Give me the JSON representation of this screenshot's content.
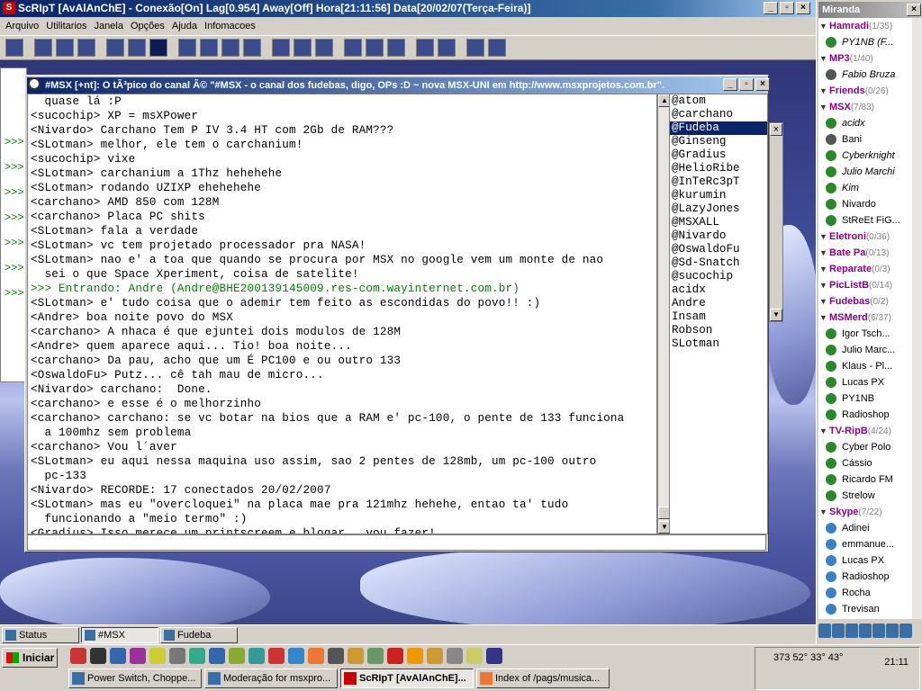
{
  "app": {
    "title": "ScRIpT [AvAlAnChE] - Conexão[On] Lag[0.954] Away[Off] Hora[21:11:56] Data[20/02/07(Terça-Feira)]",
    "menu": [
      "Arquivo",
      "Utilitarios",
      "Janela",
      "Opções",
      "Ajuda",
      "Infomacoes"
    ]
  },
  "channel": {
    "title": "#MSX [+nt]: O tÃ³pico do canal Ã© \"#MSX - o canal dos fudebas, digo, OPs :D ~ nova MSX-UNI em http://www.msxprojetos.com.br\".",
    "lines": [
      {
        "t": "  quase lá :P"
      },
      {
        "t": "<sucochip> XP = msXPower"
      },
      {
        "t": "<Nivardo> Carchano Tem P IV 3.4 HT com 2Gb de RAM???"
      },
      {
        "t": "<SLotman> melhor, ele tem o carchanium!"
      },
      {
        "t": "<sucochip> vixe"
      },
      {
        "t": "<SLotman> carchanium a 1Thz hehehehe"
      },
      {
        "t": "<SLotman> rodando UZIXP ehehehehe"
      },
      {
        "t": "<carchano> AMD 850 com 128M"
      },
      {
        "t": "<carchano> Placa PC shits"
      },
      {
        "t": "<SLotman> fala a verdade"
      },
      {
        "t": "<SLotman> vc tem projetado processador pra NASA!"
      },
      {
        "t": "<SLotman> nao e' a toa que quando se procura por MSX no google vem um monte de nao"
      },
      {
        "t": "  sei o que Space Xperiment, coisa de satelite!"
      },
      {
        "t": ">>> Entrando: Andre (Andre@BHE200139145009.res-com.wayinternet.com.br)",
        "g": true
      },
      {
        "t": "<SLotman> e' tudo coisa que o ademir tem feito as escondidas do povo!! :)"
      },
      {
        "t": "<Andre> boa noite povo do MSX"
      },
      {
        "t": "<carchano> A nhaca é que ejuntei dois modulos de 128M"
      },
      {
        "t": "<Andre> quem aparece aqui... Tio! boa noite..."
      },
      {
        "t": "<carchano> Da pau, acho que um É PC100 e ou outro 133"
      },
      {
        "t": "<OswaldoFu> Putz... cê tah mau de micro..."
      },
      {
        "t": "<Nivardo> carchano:  Done."
      },
      {
        "t": "<carchano> e esse é o melhorzinho"
      },
      {
        "t": "<carchano> carchano: se vc botar na bios que a RAM e' pc-100, o pente de 133 funciona"
      },
      {
        "t": "  a 100mhz sem problema"
      },
      {
        "t": "<carchano> Vou l´aver"
      },
      {
        "t": "<SLotman> eu aqui nessa maquina uso assim, sao 2 pentes de 128mb, um pc-100 outro"
      },
      {
        "t": "  pc-133"
      },
      {
        "t": "<Nivardo> RECORDE: 17 conectados 20/02/2007"
      },
      {
        "t": "<SLotman> mas eu \"overcloquei\" na placa mae pra 121mhz hehehe, entao ta' tudo"
      },
      {
        "t": "  funcionando a \"meio termo\" :)"
      },
      {
        "t": "<Gradius> Isso merece um printscreem e blogar.. vou fazer!"
      }
    ],
    "nicks": [
      "@atom",
      "@carchano",
      "@Fudeba",
      "@Ginseng",
      "@Gradius",
      "@HelioRibe",
      "@InTeRc3pT",
      "@kurumin",
      "@LazyJones",
      "@MSXALL",
      "@Nivardo",
      "@OswaldoFu",
      "@Sd-Snatch",
      "@sucochip",
      "acidx",
      "Andre",
      "Insam",
      "Robson",
      "SLotman"
    ],
    "selected_nick": "@Fudeba"
  },
  "bg": {
    "lines": [
      ">>>",
      ">>>",
      ">>>",
      ">>>",
      ">>>",
      ">>>",
      ">>>"
    ]
  },
  "switchbar": [
    "Status",
    "#MSX",
    "Fudeba"
  ],
  "miranda": {
    "title": "Miranda",
    "items": [
      {
        "g": "Hamradi",
        "c": "(1/35)"
      },
      {
        "n": "PY1NB (F...",
        "i": true,
        "col": "#2a8a2a"
      },
      {
        "g": "MP3",
        "c": "(1/40)"
      },
      {
        "n": "Fabio Bruza",
        "i": true,
        "col": "#555"
      },
      {
        "g": "Friends",
        "c": "(0/26)"
      },
      {
        "g": "MSX",
        "c": "(7/83)"
      },
      {
        "n": "acidx",
        "i": true,
        "col": "#2a8a2a"
      },
      {
        "n": "Bani",
        "col": "#555"
      },
      {
        "n": "Cyberknight",
        "i": true,
        "col": "#2a8a2a"
      },
      {
        "n": "Julio Marchi",
        "i": true,
        "col": "#2a8a2a"
      },
      {
        "n": "Kim",
        "i": true,
        "col": "#2a8a2a"
      },
      {
        "n": "Nivardo",
        "col": "#2a8a2a"
      },
      {
        "n": "StReEt FiG...",
        "col": "#2a8a2a"
      },
      {
        "g": "Eletroni",
        "c": "(0/36)"
      },
      {
        "g": "Bate Pa",
        "c": "(0/13)"
      },
      {
        "g": "Reparate",
        "c": "(0/3)"
      },
      {
        "g": "PicListB",
        "c": "(0/14)"
      },
      {
        "g": "Fudebas",
        "c": "(0/2)"
      },
      {
        "g": "MSMerd",
        "c": "(6/37)"
      },
      {
        "n": "Igor Tsch...",
        "col": "#2a8a2a"
      },
      {
        "n": "Julio Marc...",
        "col": "#2a8a2a"
      },
      {
        "n": "Klaus - Pl...",
        "col": "#2a8a2a"
      },
      {
        "n": "Lucas PX",
        "col": "#2a8a2a"
      },
      {
        "n": "PY1NB",
        "col": "#2a8a2a"
      },
      {
        "n": "Radioshop",
        "col": "#2a8a2a"
      },
      {
        "g": "TV-RipB",
        "c": "(4/24)"
      },
      {
        "n": "Cyber Polo",
        "col": "#2a8a2a"
      },
      {
        "n": "Cássio",
        "col": "#2a8a2a"
      },
      {
        "n": "Ricardo FM",
        "col": "#2a8a2a"
      },
      {
        "n": "Strelow",
        "col": "#2a8a2a"
      },
      {
        "g": "Skype",
        "c": "(7/22)"
      },
      {
        "n": "Adinei",
        "col": "#3a80c8"
      },
      {
        "n": "emmanue...",
        "col": "#3a80c8"
      },
      {
        "n": "Lucas PX",
        "col": "#3a80c8"
      },
      {
        "n": "Radioshop",
        "col": "#3a80c8"
      },
      {
        "n": "Rocha",
        "col": "#3a80c8"
      },
      {
        "n": "Trevisan",
        "col": "#3a80c8"
      }
    ]
  },
  "taskbar": {
    "start": "Iniciar",
    "tasks": [
      "Power Switch, Choppe...",
      "Moderação for msxpro...",
      "ScRIpT [AvAlAnChE]...",
      "Index of /pags/musica..."
    ],
    "active": 2,
    "tray_text": "373 52° 33° 43°",
    "clock": "21:11"
  }
}
